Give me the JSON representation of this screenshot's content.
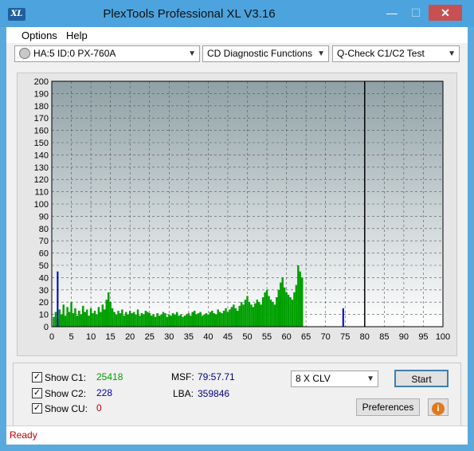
{
  "window": {
    "title": "PlexTools Professional XL V3.16",
    "icon": "xl-logo-icon"
  },
  "menu": {
    "items": [
      {
        "label": "Options"
      },
      {
        "label": "Help"
      }
    ]
  },
  "toolbar": {
    "drive": "HA:5 ID:0  PX-760A",
    "function": "CD Diagnostic Functions",
    "test": "Q-Check C1/C2 Test"
  },
  "chart_data": {
    "type": "bar",
    "title": "",
    "xlabel": "",
    "ylabel": "",
    "xlim": [
      0,
      100
    ],
    "ylim": [
      0,
      200
    ],
    "x_ticks": [
      "0",
      "5",
      "10",
      "15",
      "20",
      "25",
      "30",
      "35",
      "40",
      "45",
      "50",
      "55",
      "60",
      "65",
      "70",
      "75",
      "80",
      "85",
      "90",
      "95",
      "100"
    ],
    "y_ticks": [
      "200",
      "190",
      "180",
      "170",
      "160",
      "150",
      "140",
      "130",
      "120",
      "110",
      "100",
      "90",
      "80",
      "70",
      "60",
      "50",
      "40",
      "30",
      "20",
      "10",
      "0"
    ],
    "grid": true,
    "end_marker_x": 80,
    "series": [
      {
        "color": "#00a000",
        "x_start": 0.5,
        "x_step": 0.5,
        "values": [
          8,
          12,
          6,
          14,
          10,
          18,
          9,
          16,
          12,
          20,
          11,
          15,
          9,
          13,
          10,
          17,
          12,
          14,
          9,
          15,
          11,
          13,
          10,
          16,
          12,
          18,
          14,
          22,
          28,
          20,
          15,
          12,
          10,
          13,
          11,
          14,
          9,
          12,
          10,
          13,
          11,
          12,
          10,
          14,
          9,
          11,
          10,
          13,
          12,
          11,
          9,
          10,
          8,
          11,
          9,
          10,
          12,
          11,
          8,
          10,
          9,
          11,
          10,
          12,
          9,
          10,
          8,
          9,
          10,
          11,
          9,
          12,
          13,
          10,
          11,
          12,
          9,
          10,
          11,
          10,
          12,
          13,
          11,
          10,
          14,
          12,
          11,
          13,
          15,
          12,
          14,
          16,
          18,
          15,
          13,
          17,
          20,
          18,
          22,
          25,
          20,
          18,
          16,
          19,
          22,
          20,
          18,
          24,
          28,
          30,
          25,
          22,
          20,
          18,
          24,
          30,
          36,
          40,
          32,
          28,
          26,
          24,
          22,
          28,
          34,
          50,
          45,
          40
        ]
      },
      {
        "color": "#0000c0",
        "x": [
          1.5,
          74.5
        ],
        "values": [
          45,
          15
        ]
      }
    ]
  },
  "controls": {
    "show_c1": {
      "label": "Show C1:",
      "value": "25418",
      "checked": true
    },
    "show_c2": {
      "label": "Show C2:",
      "value": "228",
      "checked": true
    },
    "show_cu": {
      "label": "Show CU:",
      "value": "0",
      "checked": true
    },
    "msf": {
      "label": "MSF:",
      "value": "79:57.71"
    },
    "lba": {
      "label": "LBA:",
      "value": "359846"
    },
    "speed": "8 X CLV",
    "start": "Start",
    "preferences": "Preferences"
  },
  "status": "Ready",
  "colors": {
    "c1": "#00a000",
    "c2": "#0000c0",
    "cu": "#c00000",
    "msf": "#000080",
    "title_bar": "#4da3dd"
  }
}
